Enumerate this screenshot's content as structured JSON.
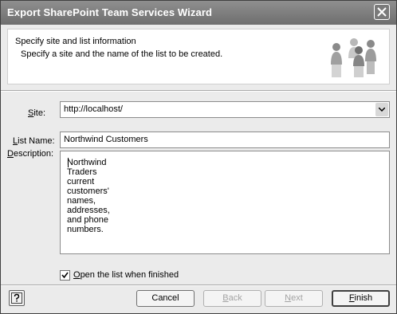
{
  "window": {
    "title": "Export SharePoint Team Services Wizard"
  },
  "header": {
    "title": "Specify site and list information",
    "subtitle": "Specify a site and the name of the list to be created."
  },
  "form": {
    "site_label_prefix": "",
    "site_label_accel": "S",
    "site_label_rest": "ite:",
    "site_value": "http://localhost/",
    "list_name_label_accel": "L",
    "list_name_label_rest": "ist Name:",
    "list_name_value": "Northwind Customers",
    "description_label_accel": "D",
    "description_label_rest": "escription:",
    "description_value": "Northwind Traders current customers' names, addresses, and phone numbers.",
    "open_list_checked": true,
    "open_list_label_accel": "O",
    "open_list_label_rest": "pen the list when finished"
  },
  "buttons": {
    "cancel": "Cancel",
    "back_accel": "B",
    "back_rest": "ack",
    "next_accel": "N",
    "next_rest": "ext",
    "finish_accel": "F",
    "finish_rest": "inish"
  }
}
